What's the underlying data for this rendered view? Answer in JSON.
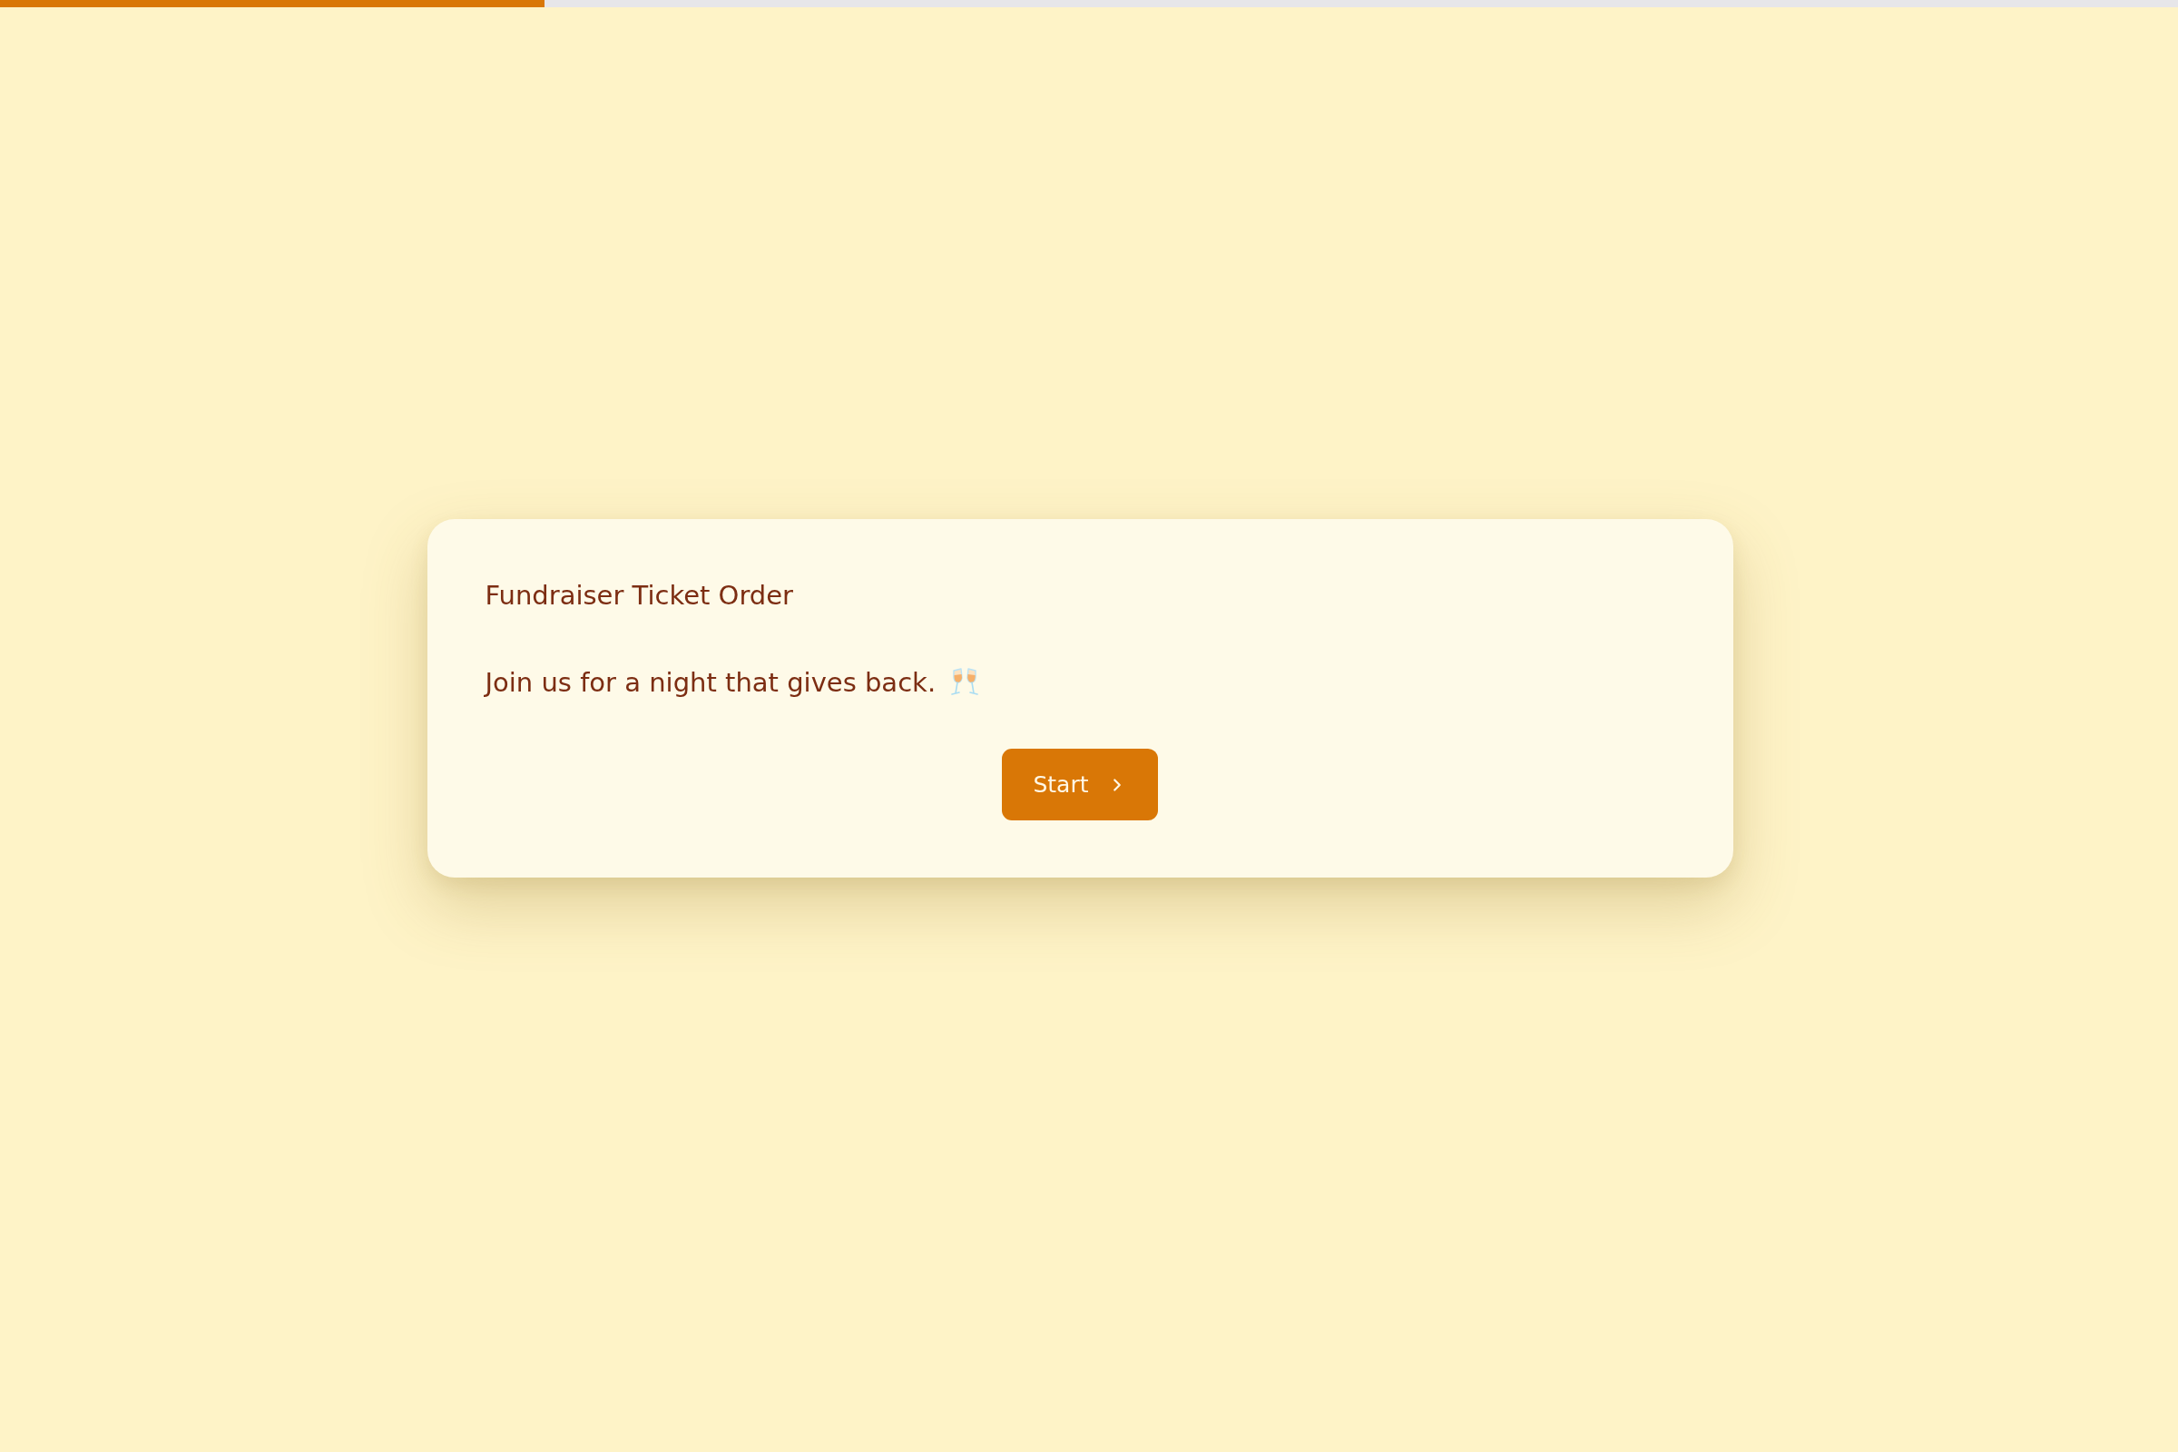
{
  "progress": {
    "level": 0.25
  },
  "card": {
    "title": "Fundraiser Ticket Order",
    "message": "Join us for a night that gives back.",
    "start_button": {
      "label": "Start"
    }
  }
}
